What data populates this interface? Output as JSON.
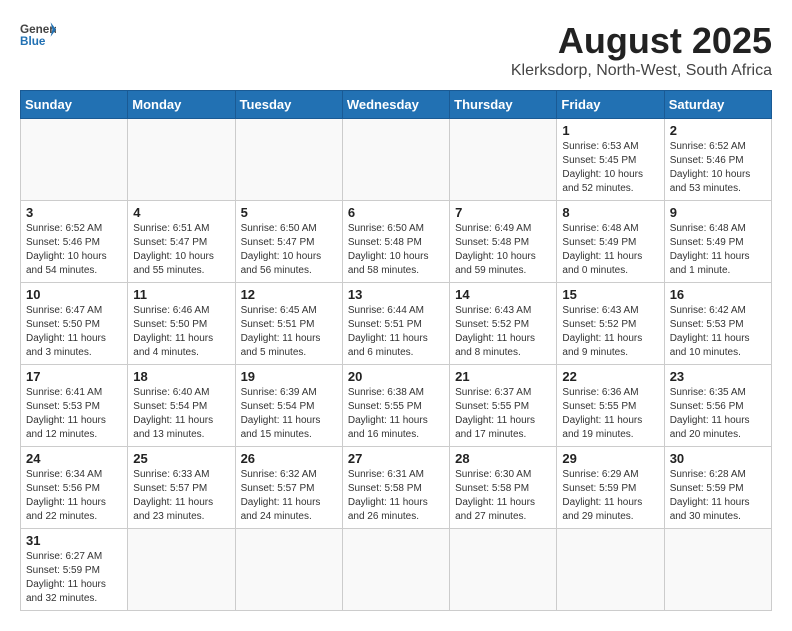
{
  "header": {
    "logo_general": "General",
    "logo_blue": "Blue",
    "month_year": "August 2025",
    "location": "Klerksdorp, North-West, South Africa"
  },
  "weekdays": [
    "Sunday",
    "Monday",
    "Tuesday",
    "Wednesday",
    "Thursday",
    "Friday",
    "Saturday"
  ],
  "weeks": [
    [
      {
        "day": "",
        "info": ""
      },
      {
        "day": "",
        "info": ""
      },
      {
        "day": "",
        "info": ""
      },
      {
        "day": "",
        "info": ""
      },
      {
        "day": "",
        "info": ""
      },
      {
        "day": "1",
        "info": "Sunrise: 6:53 AM\nSunset: 5:45 PM\nDaylight: 10 hours\nand 52 minutes."
      },
      {
        "day": "2",
        "info": "Sunrise: 6:52 AM\nSunset: 5:46 PM\nDaylight: 10 hours\nand 53 minutes."
      }
    ],
    [
      {
        "day": "3",
        "info": "Sunrise: 6:52 AM\nSunset: 5:46 PM\nDaylight: 10 hours\nand 54 minutes."
      },
      {
        "day": "4",
        "info": "Sunrise: 6:51 AM\nSunset: 5:47 PM\nDaylight: 10 hours\nand 55 minutes."
      },
      {
        "day": "5",
        "info": "Sunrise: 6:50 AM\nSunset: 5:47 PM\nDaylight: 10 hours\nand 56 minutes."
      },
      {
        "day": "6",
        "info": "Sunrise: 6:50 AM\nSunset: 5:48 PM\nDaylight: 10 hours\nand 58 minutes."
      },
      {
        "day": "7",
        "info": "Sunrise: 6:49 AM\nSunset: 5:48 PM\nDaylight: 10 hours\nand 59 minutes."
      },
      {
        "day": "8",
        "info": "Sunrise: 6:48 AM\nSunset: 5:49 PM\nDaylight: 11 hours\nand 0 minutes."
      },
      {
        "day": "9",
        "info": "Sunrise: 6:48 AM\nSunset: 5:49 PM\nDaylight: 11 hours\nand 1 minute."
      }
    ],
    [
      {
        "day": "10",
        "info": "Sunrise: 6:47 AM\nSunset: 5:50 PM\nDaylight: 11 hours\nand 3 minutes."
      },
      {
        "day": "11",
        "info": "Sunrise: 6:46 AM\nSunset: 5:50 PM\nDaylight: 11 hours\nand 4 minutes."
      },
      {
        "day": "12",
        "info": "Sunrise: 6:45 AM\nSunset: 5:51 PM\nDaylight: 11 hours\nand 5 minutes."
      },
      {
        "day": "13",
        "info": "Sunrise: 6:44 AM\nSunset: 5:51 PM\nDaylight: 11 hours\nand 6 minutes."
      },
      {
        "day": "14",
        "info": "Sunrise: 6:43 AM\nSunset: 5:52 PM\nDaylight: 11 hours\nand 8 minutes."
      },
      {
        "day": "15",
        "info": "Sunrise: 6:43 AM\nSunset: 5:52 PM\nDaylight: 11 hours\nand 9 minutes."
      },
      {
        "day": "16",
        "info": "Sunrise: 6:42 AM\nSunset: 5:53 PM\nDaylight: 11 hours\nand 10 minutes."
      }
    ],
    [
      {
        "day": "17",
        "info": "Sunrise: 6:41 AM\nSunset: 5:53 PM\nDaylight: 11 hours\nand 12 minutes."
      },
      {
        "day": "18",
        "info": "Sunrise: 6:40 AM\nSunset: 5:54 PM\nDaylight: 11 hours\nand 13 minutes."
      },
      {
        "day": "19",
        "info": "Sunrise: 6:39 AM\nSunset: 5:54 PM\nDaylight: 11 hours\nand 15 minutes."
      },
      {
        "day": "20",
        "info": "Sunrise: 6:38 AM\nSunset: 5:55 PM\nDaylight: 11 hours\nand 16 minutes."
      },
      {
        "day": "21",
        "info": "Sunrise: 6:37 AM\nSunset: 5:55 PM\nDaylight: 11 hours\nand 17 minutes."
      },
      {
        "day": "22",
        "info": "Sunrise: 6:36 AM\nSunset: 5:55 PM\nDaylight: 11 hours\nand 19 minutes."
      },
      {
        "day": "23",
        "info": "Sunrise: 6:35 AM\nSunset: 5:56 PM\nDaylight: 11 hours\nand 20 minutes."
      }
    ],
    [
      {
        "day": "24",
        "info": "Sunrise: 6:34 AM\nSunset: 5:56 PM\nDaylight: 11 hours\nand 22 minutes."
      },
      {
        "day": "25",
        "info": "Sunrise: 6:33 AM\nSunset: 5:57 PM\nDaylight: 11 hours\nand 23 minutes."
      },
      {
        "day": "26",
        "info": "Sunrise: 6:32 AM\nSunset: 5:57 PM\nDaylight: 11 hours\nand 24 minutes."
      },
      {
        "day": "27",
        "info": "Sunrise: 6:31 AM\nSunset: 5:58 PM\nDaylight: 11 hours\nand 26 minutes."
      },
      {
        "day": "28",
        "info": "Sunrise: 6:30 AM\nSunset: 5:58 PM\nDaylight: 11 hours\nand 27 minutes."
      },
      {
        "day": "29",
        "info": "Sunrise: 6:29 AM\nSunset: 5:59 PM\nDaylight: 11 hours\nand 29 minutes."
      },
      {
        "day": "30",
        "info": "Sunrise: 6:28 AM\nSunset: 5:59 PM\nDaylight: 11 hours\nand 30 minutes."
      }
    ],
    [
      {
        "day": "31",
        "info": "Sunrise: 6:27 AM\nSunset: 5:59 PM\nDaylight: 11 hours\nand 32 minutes."
      },
      {
        "day": "",
        "info": ""
      },
      {
        "day": "",
        "info": ""
      },
      {
        "day": "",
        "info": ""
      },
      {
        "day": "",
        "info": ""
      },
      {
        "day": "",
        "info": ""
      },
      {
        "day": "",
        "info": ""
      }
    ]
  ]
}
